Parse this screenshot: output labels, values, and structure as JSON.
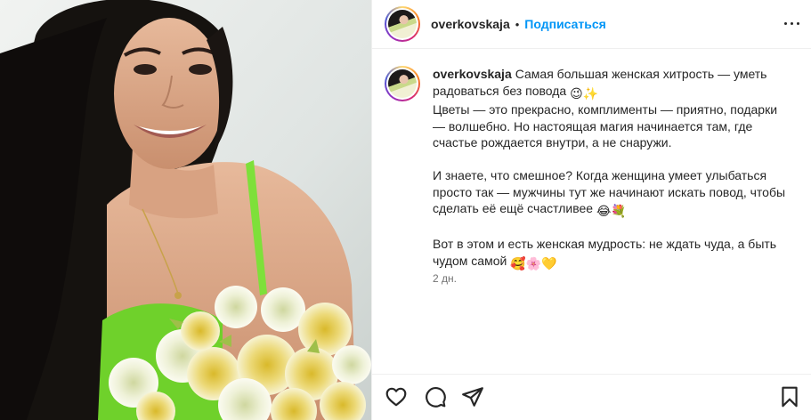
{
  "header": {
    "username": "overkovskaja",
    "separator": "•",
    "follow_label": "Подписаться"
  },
  "caption": {
    "username": "overkovskaja",
    "lines": [
      "Самая большая женская хитрость — уметь радоваться без повода",
      "Цветы — это прекрасно, комплименты — приятно, подарки — волшебно. Но настоящая магия начинается там, где счастье рождается внутри, а не снаружи.",
      "И знаете, что смешное? Когда женщина умеет улыбаться просто так — мужчины тут же начинают искать повод, чтобы сделать её ещё счастливее",
      "Вот в этом и есть женская мудрость: не ждать чуда, а быть чудом самой"
    ],
    "emojis": [
      "😉",
      "✨",
      "😂",
      "💐",
      "🥰",
      "🌸",
      "💛"
    ],
    "time": "2 дн."
  },
  "icons": {
    "more": "more-options-icon",
    "like": "heart-icon",
    "comment": "comment-icon",
    "share": "share-icon",
    "save": "bookmark-icon"
  },
  "colors": {
    "accent": "#0095f6",
    "text": "#262626",
    "secondary": "#737373",
    "border": "#efefef"
  }
}
